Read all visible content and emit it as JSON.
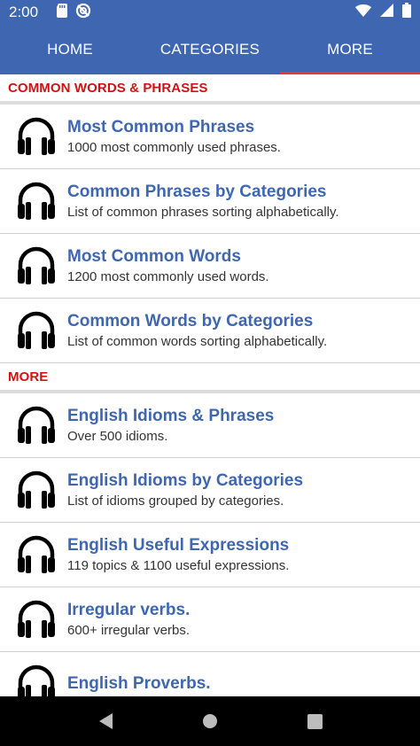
{
  "status_bar": {
    "time": "2:00",
    "icons_left": [
      "sd-card-icon",
      "no-sync-icon"
    ],
    "icons_right": [
      "wifi-icon",
      "signal-icon",
      "battery-icon"
    ]
  },
  "tabs": [
    {
      "label": "HOME",
      "active": false
    },
    {
      "label": "CATEGORIES",
      "active": false
    },
    {
      "label": "MORE",
      "active": true
    }
  ],
  "sections": [
    {
      "header": "COMMON WORDS & PHRASES",
      "items": [
        {
          "title": "Most Common Phrases",
          "subtitle": "1000 most commonly used phrases.",
          "icon": "headphones-icon"
        },
        {
          "title": "Common Phrases by Categories",
          "subtitle": "List of common phrases sorting alphabetically.",
          "icon": "headphones-icon"
        },
        {
          "title": "Most Common Words",
          "subtitle": "1200 most commonly used words.",
          "icon": "headphones-icon"
        },
        {
          "title": "Common Words by Categories",
          "subtitle": "List of common words sorting alphabetically.",
          "icon": "headphones-icon"
        }
      ]
    },
    {
      "header": "MORE",
      "items": [
        {
          "title": "English Idioms & Phrases",
          "subtitle": "Over 500 idioms.",
          "icon": "headphones-icon"
        },
        {
          "title": "English Idioms by Categories",
          "subtitle": "List of idioms grouped by categories.",
          "icon": "headphones-icon"
        },
        {
          "title": "English Useful Expressions",
          "subtitle": "119 topics & 1100 useful expressions.",
          "icon": "headphones-icon"
        },
        {
          "title": "Irregular verbs.",
          "subtitle": "600+ irregular verbs.",
          "icon": "headphones-icon"
        },
        {
          "title": "English Proverbs.",
          "subtitle": "",
          "icon": "headphones-icon"
        }
      ]
    }
  ],
  "nav_bar": {
    "buttons": [
      "back-icon",
      "home-icon",
      "recents-icon"
    ]
  },
  "colors": {
    "primary": "#3f67b1",
    "accent": "#e53935",
    "section_header": "#d01212",
    "title_text": "#3f67b1"
  }
}
